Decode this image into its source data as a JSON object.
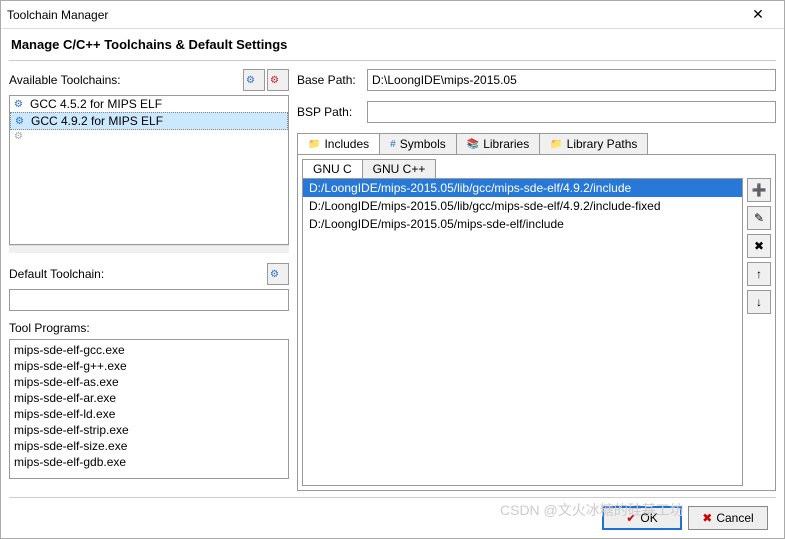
{
  "window": {
    "title": "Toolchain Manager"
  },
  "subtitle": "Manage C/C++ Toolchains & Default Settings",
  "available": {
    "label": "Available Toolchains:",
    "items": [
      "GCC 4.5.2 for MIPS ELF",
      "GCC 4.9.2 for MIPS ELF"
    ],
    "selected_index": 1
  },
  "default_toolchain": {
    "label": "Default Toolchain:",
    "value": ""
  },
  "tool_programs": {
    "label": "Tool Programs:",
    "items": [
      "mips-sde-elf-gcc.exe",
      "mips-sde-elf-g++.exe",
      "mips-sde-elf-as.exe",
      "mips-sde-elf-ar.exe",
      "mips-sde-elf-ld.exe",
      "mips-sde-elf-strip.exe",
      "mips-sde-elf-size.exe",
      "mips-sde-elf-gdb.exe"
    ]
  },
  "base_path": {
    "label": "Base Path:",
    "value": "D:\\LoongIDE\\mips-2015.05"
  },
  "bsp_path": {
    "label": "BSP Path:",
    "value": ""
  },
  "tabs": {
    "includes": "Includes",
    "symbols": "Symbols",
    "libraries": "Libraries",
    "library_paths": "Library Paths"
  },
  "subtabs": {
    "gnuc": "GNU C",
    "gnucpp": "GNU C++"
  },
  "includes": {
    "items": [
      "D:/LoongIDE/mips-2015.05/lib/gcc/mips-sde-elf/4.9.2/include",
      "D:/LoongIDE/mips-2015.05/lib/gcc/mips-sde-elf/4.9.2/include-fixed",
      "D:/LoongIDE/mips-2015.05/mips-sde-elf/include"
    ],
    "selected_index": 0
  },
  "buttons": {
    "ok": "OK",
    "cancel": "Cancel"
  },
  "watermark": "CSDN @文火冰糖的硅基工坊"
}
